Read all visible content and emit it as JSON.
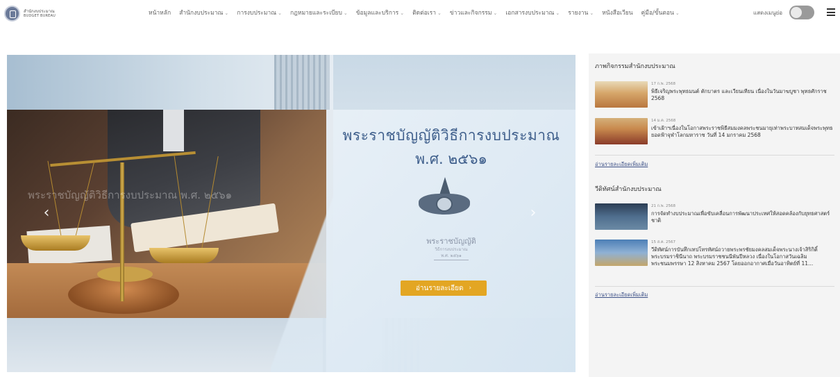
{
  "logo": {
    "name_th": "สำนักงบประมาณ",
    "name_en": "BUDGET BUREAU"
  },
  "nav": {
    "items": [
      {
        "label": "หน้าหลัก",
        "has_dropdown": false
      },
      {
        "label": "สำนักงบประมาณ",
        "has_dropdown": true
      },
      {
        "label": "การงบประมาณ",
        "has_dropdown": true
      },
      {
        "label": "กฎหมายและระเบียบ",
        "has_dropdown": true
      },
      {
        "label": "ข้อมูลและบริการ",
        "has_dropdown": true
      },
      {
        "label": "ติดต่อเรา",
        "has_dropdown": true
      },
      {
        "label": "ข่าวและกิจกรรม",
        "has_dropdown": true
      },
      {
        "label": "เอกสารงบประมาณ",
        "has_dropdown": true
      },
      {
        "label": "รายงาน",
        "has_dropdown": true
      },
      {
        "label": "หนังสือเวียน",
        "has_dropdown": false
      },
      {
        "label": "คู่มือ/ขั้นตอน",
        "has_dropdown": true
      }
    ],
    "dropdown_caret": "⌄",
    "toggle_label": "แสดงเมนูย่อ",
    "toggle_on": false
  },
  "hero": {
    "title": "พระราชบัญญัติวิธีการงบประมาณ",
    "subtitle": "พ.ศ. ๒๕๖๑",
    "watermark": "พระราชบัญญัติวิธีการงบประมาณ พ.ศ. ๒๕๖๑",
    "book_title": "พระราชบัญญัติ",
    "book_sub": "วิธีการงบประมาณ",
    "book_year": "พ.ศ. ๒๕๖๑",
    "button_label": "อ่านรายละเอียด",
    "button_chevron": "›",
    "prev_arrow": "‹",
    "next_arrow": "›",
    "accent_color": "#e3a623",
    "title_color": "#3f5f8c"
  },
  "sidebar": {
    "activities": {
      "heading": "ภาพกิจกรรมสำนักงบประมาณ",
      "items": [
        {
          "date": "17 ก.พ. 2568",
          "title": "พิธีเจริญพระพุทธมนต์ ตักบาตร และเวียนเทียน เนื่องในวันมาฆบูชา พุทธศักราช 2568"
        },
        {
          "date": "14 ม.ค. 2568",
          "title": "เข้าเฝ้าฯเนื่องในโอกาสพระราชพิธีสมมงคลพระชนมายุเท่าพระบาทสมเด็จพระพุทธยอดฟ้าจุฬาโลกมหาราช วันที่ 14 มกราคม 2568"
        }
      ],
      "more_label": "อ่านรายละเอียดเพิ่มเติม"
    },
    "videos": {
      "heading": "วีดิทัศน์สำนักงบประมาณ",
      "items": [
        {
          "date": "21 ก.พ. 2568",
          "title": "การจัดทำงบประมาณเพื่อขับเคลื่อนการพัฒนาประเทศให้สอดคล้องกับยุทธศาสตร์ชาติ"
        },
        {
          "date": "15 ส.ค. 2567",
          "title": "วีดิทัศน์การบันทึกเทปโทรทัศน์ถวายพระพรชัยมงคลสมเด็จพระนางเจ้าสิริกิติ์ พระบรมราชินีนาถ พระบรมราชชนนีพันปีหลวง เนื่องในโอกาสวันเฉลิมพระชนมพรรษา 12 สิงหาคม 2567 โดยออกอากาศเมื่อวันอาทิตย์ที่ 11..."
        }
      ],
      "more_label": "อ่านรายละเอียดเพิ่มเติม"
    }
  }
}
